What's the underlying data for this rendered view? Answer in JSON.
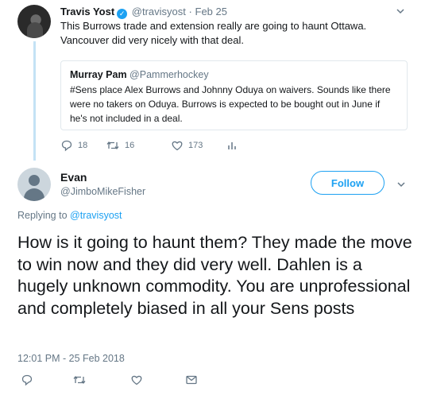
{
  "parent": {
    "name": "Travis Yost",
    "handle": "@travisyost",
    "dot": "·",
    "date": "Feb 25",
    "text": "This Burrows trade and extension really are going to haunt Ottawa. Vancouver did very nicely with that deal.",
    "quote": {
      "name": "Murray Pam",
      "handle": "@Pammerhockey",
      "text": "#Sens place Alex Burrows and Johnny Oduya on waivers. Sounds like there were no takers on Oduya. Burrows is expected to be bought out in June if he's not included in a deal."
    },
    "replies": "18",
    "retweets": "16",
    "likes": "173"
  },
  "main": {
    "name": "Evan",
    "handle": "@JimboMikeFisher",
    "follow_label": "Follow",
    "replying_prefix": "Replying to",
    "replying_handle": "@travisyost",
    "text": "How is it going to haunt them? They made the move to win now and they did very well. Dahlen is a hugely unknown commodity. You are unprofessional and completely biased in all your Sens posts",
    "timestamp": "12:01 PM - 25 Feb 2018"
  },
  "icons": {
    "verified": "verified-badge-icon",
    "reply": "reply-icon",
    "retweet": "retweet-icon",
    "like": "heart-icon",
    "analytics": "analytics-icon",
    "dm": "envelope-icon",
    "more": "chevron-down-icon"
  },
  "colors": {
    "accent": "#1da1f2",
    "muted": "#657786",
    "thread_line": "#c4e2f5",
    "border": "#e1e8ed"
  }
}
